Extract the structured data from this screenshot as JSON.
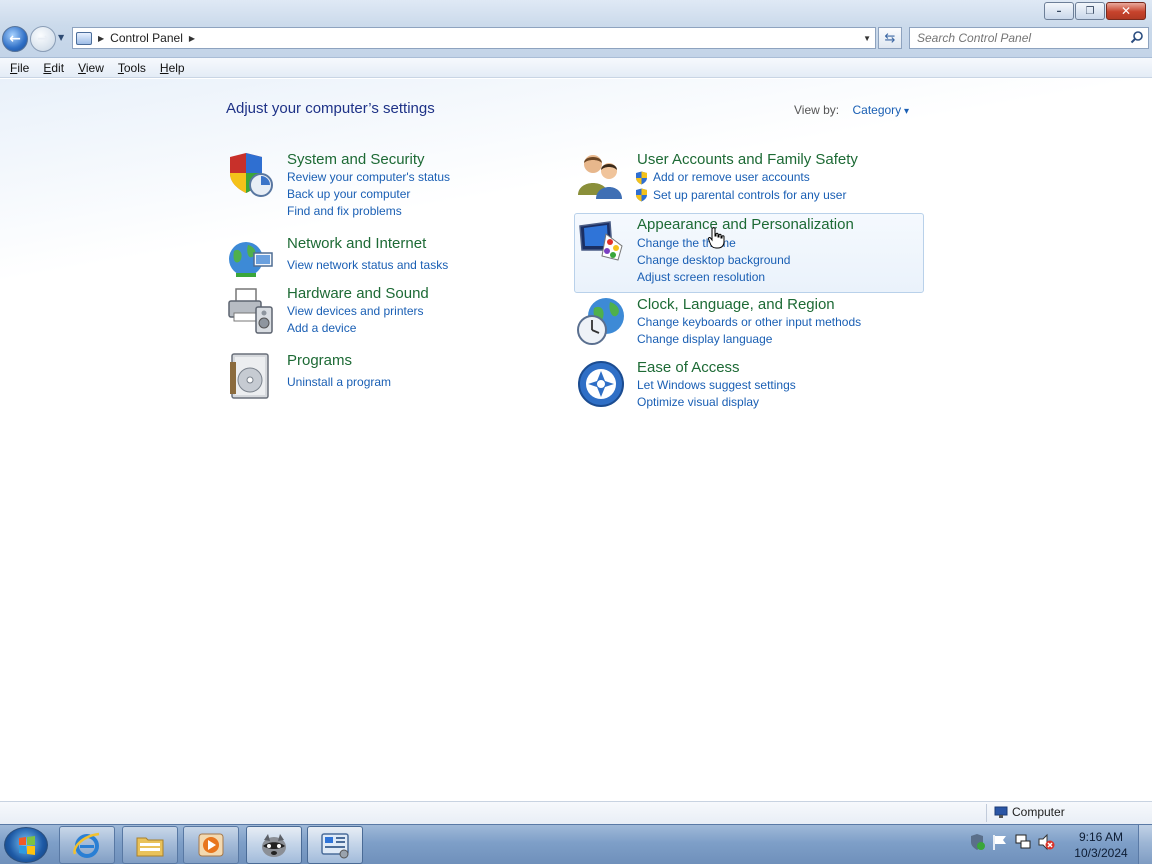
{
  "window": {
    "minimize_glyph": "–",
    "restore_glyph": "❐",
    "close_glyph": "✕"
  },
  "address": {
    "path": [
      "Control Panel"
    ],
    "search_placeholder": "Search Control Panel"
  },
  "menubar": {
    "items": [
      "File",
      "Edit",
      "View",
      "Tools",
      "Help"
    ]
  },
  "main": {
    "heading": "Adjust your computer’s settings",
    "view_by_label": "View by:",
    "view_by_value": "Category",
    "categories": [
      {
        "title": "System and Security",
        "icon": "shield-icon",
        "links": [
          "Review your computer's status",
          "Back up your computer",
          "Find and fix problems"
        ]
      },
      {
        "title": "Network and Internet",
        "icon": "network-globe-icon",
        "links": [
          "View network status and tasks"
        ]
      },
      {
        "title": "Hardware and Sound",
        "icon": "printer-speaker-icon",
        "links": [
          "View devices and printers",
          "Add a device"
        ]
      },
      {
        "title": "Programs",
        "icon": "programs-disc-icon",
        "links": [
          "Uninstall a program"
        ]
      },
      {
        "title": "User Accounts and Family Safety",
        "icon": "users-icon",
        "links": [
          "Add or remove user accounts",
          "Set up parental controls for any user"
        ]
      },
      {
        "title": "Appearance and Personalization",
        "icon": "monitor-palette-icon",
        "links": [
          "Change the theme",
          "Change desktop background",
          "Adjust screen resolution"
        ]
      },
      {
        "title": "Clock, Language, and Region",
        "icon": "clock-globe-icon",
        "links": [
          "Change keyboards or other input methods",
          "Change display language"
        ]
      },
      {
        "title": "Ease of Access",
        "icon": "ease-of-access-icon",
        "links": [
          "Let Windows suggest settings",
          "Optimize visual display"
        ]
      }
    ]
  },
  "statusbar": {
    "location": "Computer"
  },
  "taskbar": {
    "time": "9:16 AM",
    "date": "10/3/2024",
    "apps": [
      "internet-explorer-icon",
      "explorer-folder-icon",
      "media-player-icon",
      "raccoon-app-icon",
      "control-panel-icon"
    ]
  },
  "colors": {
    "category_title": "#1d6a35",
    "category_title_hover": "#17a83a",
    "link": "#1a5fb4",
    "heading": "#1e3287"
  }
}
